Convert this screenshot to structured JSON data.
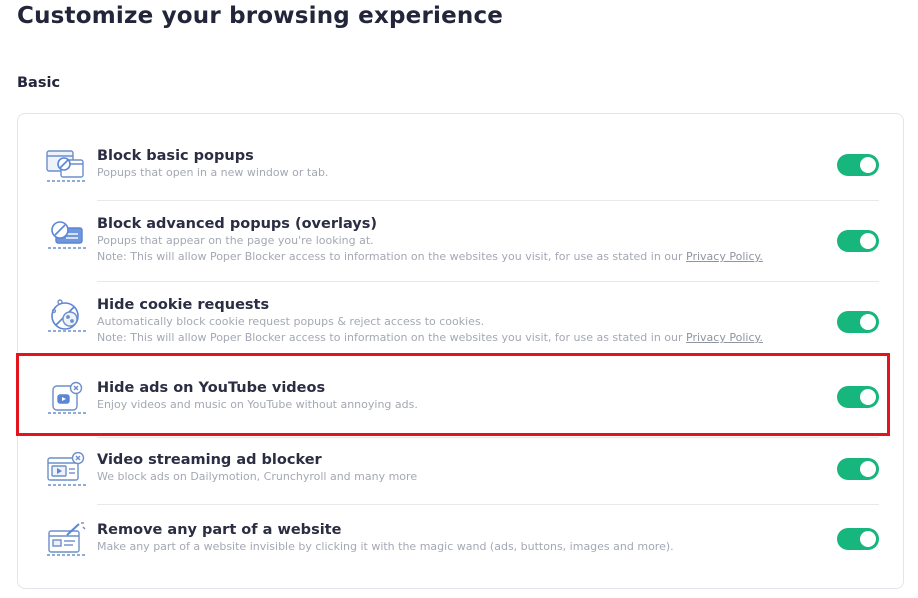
{
  "page": {
    "title": "Customize your browsing experience",
    "section": "Basic"
  },
  "settings": [
    {
      "icon": "popup-window-icon",
      "title": "Block basic popups",
      "desc": "Popups that open in a new window or tab.",
      "enabled": true
    },
    {
      "icon": "overlay-popup-icon",
      "title": "Block advanced popups (overlays)",
      "desc": "Popups that appear on the page you're looking at.",
      "note": "Note: This will allow Poper Blocker access to information on the websites you visit, for use as stated in our",
      "link": "Privacy Policy.",
      "enabled": true
    },
    {
      "icon": "cookie-icon",
      "title": "Hide cookie requests",
      "desc": "Automatically block cookie request popups & reject access to cookies.",
      "note": "Note: This will allow Poper Blocker access to information on the websites you visit, for use as stated in our",
      "link": "Privacy Policy.",
      "enabled": true
    },
    {
      "icon": "youtube-ads-icon",
      "title": "Hide ads on YouTube videos",
      "desc": "Enjoy videos and music on YouTube without annoying ads.",
      "enabled": true
    },
    {
      "icon": "video-streaming-icon",
      "title": "Video streaming ad blocker",
      "desc": "We block ads on Dailymotion, Crunchyroll and many more",
      "enabled": true
    },
    {
      "icon": "magic-wand-icon",
      "title": "Remove any part of a website",
      "desc": "Make any part of a website invisible by clicking it with the magic wand (ads, buttons, images and more).",
      "enabled": true
    }
  ],
  "colors": {
    "toggle_on": "#17b67c",
    "highlight": "#e3141e",
    "icon_stroke": "#6c8fc9",
    "icon_fill": "#5b86d6"
  }
}
